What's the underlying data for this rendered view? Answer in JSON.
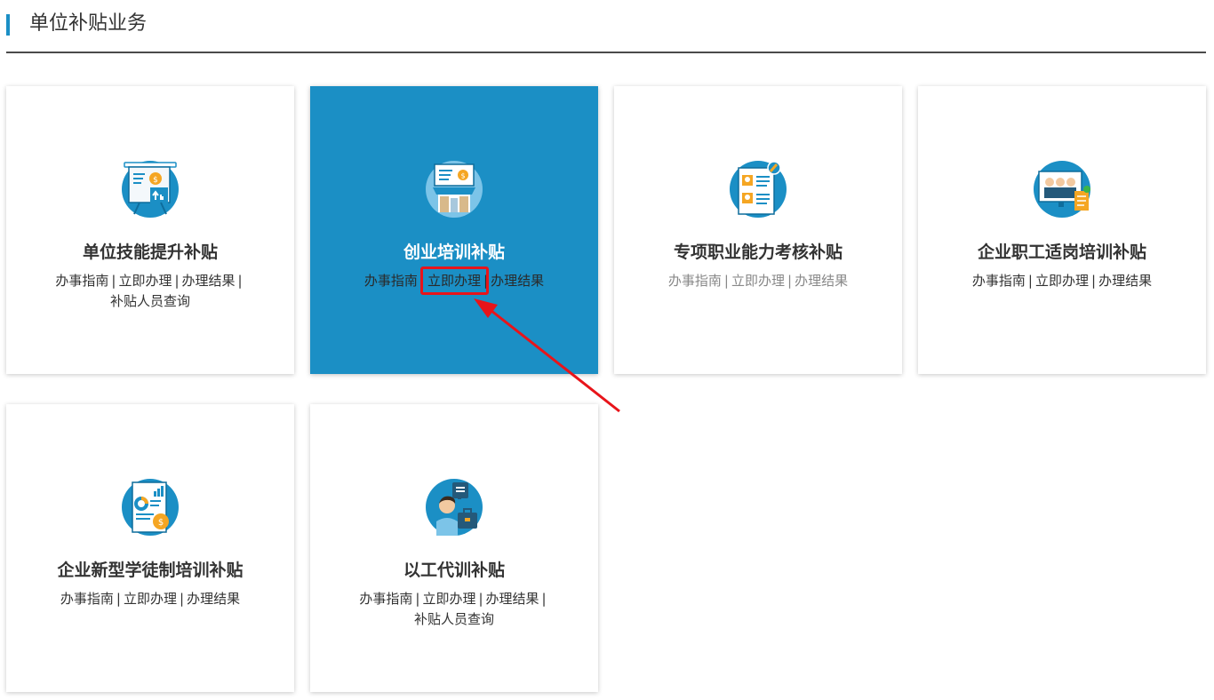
{
  "section": {
    "title": "单位补贴业务"
  },
  "cards": [
    {
      "title": "单位技能提升补贴",
      "icon": "presentation-chart-icon",
      "links": [
        "办事指南",
        "立即办理",
        "办理结果",
        "补贴人员查询"
      ]
    },
    {
      "title": "创业培训补贴",
      "icon": "shop-storefront-icon",
      "links": [
        "办事指南",
        "立即办理",
        "办理结果"
      ]
    },
    {
      "title": "专项职业能力考核补贴",
      "icon": "document-certificate-icon",
      "links": [
        "办事指南",
        "立即办理",
        "办理结果"
      ]
    },
    {
      "title": "企业职工适岗培训补贴",
      "icon": "team-screen-icon",
      "links": [
        "办事指南",
        "立即办理",
        "办理结果"
      ]
    },
    {
      "title": "企业新型学徒制培训补贴",
      "icon": "report-chart-icon",
      "links": [
        "办事指南",
        "立即办理",
        "办理结果"
      ]
    },
    {
      "title": "以工代训补贴",
      "icon": "worker-hire-icon",
      "links": [
        "办事指南",
        "立即办理",
        "办理结果",
        "补贴人员查询"
      ]
    }
  ],
  "sep": "|",
  "colors": {
    "accent": "#1b8fc5",
    "highlight": "#e8141a"
  }
}
